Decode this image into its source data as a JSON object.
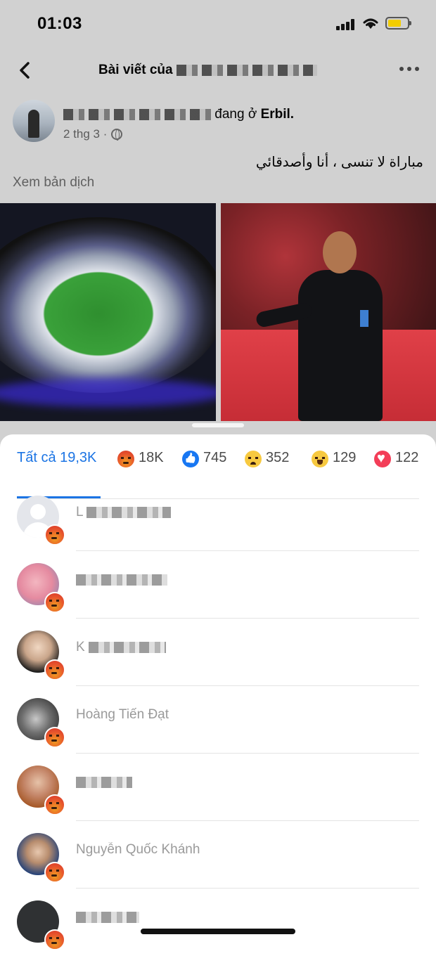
{
  "status_bar": {
    "time": "01:03"
  },
  "nav": {
    "title_prefix": "Bài viết của"
  },
  "post": {
    "author_suffix": "đang ở",
    "location": "Erbil.",
    "date": "2 thg 3 ·",
    "text": "مباراة لا تنسى ، أنا وأصدقائي",
    "translate_label": "Xem bản dịch"
  },
  "reactions": {
    "tabs": [
      {
        "label": "Tất cả 19,3K",
        "type": "all"
      },
      {
        "label": "18K",
        "type": "angry"
      },
      {
        "label": "745",
        "type": "like"
      },
      {
        "label": "352",
        "type": "sad"
      },
      {
        "label": "129",
        "type": "haha"
      },
      {
        "label": "122",
        "type": "love"
      }
    ],
    "active_tab": "all",
    "accent_color": "#1b74e4"
  },
  "users": [
    {
      "visible_name": "L",
      "avatar": "default",
      "reaction": "angry"
    },
    {
      "visible_name": "",
      "avatar": "pink",
      "reaction": "angry"
    },
    {
      "visible_name": "K",
      "avatar": "girl",
      "reaction": "angry"
    },
    {
      "visible_name": "Hoàng Tiến Đạt",
      "avatar": "mono",
      "reaction": "angry"
    },
    {
      "visible_name": "",
      "avatar": "orange",
      "reaction": "angry"
    },
    {
      "visible_name": "Nguyễn Quốc Khánh",
      "avatar": "boy",
      "reaction": "angry"
    },
    {
      "visible_name": "",
      "avatar": "dark",
      "reaction": "angry"
    }
  ]
}
